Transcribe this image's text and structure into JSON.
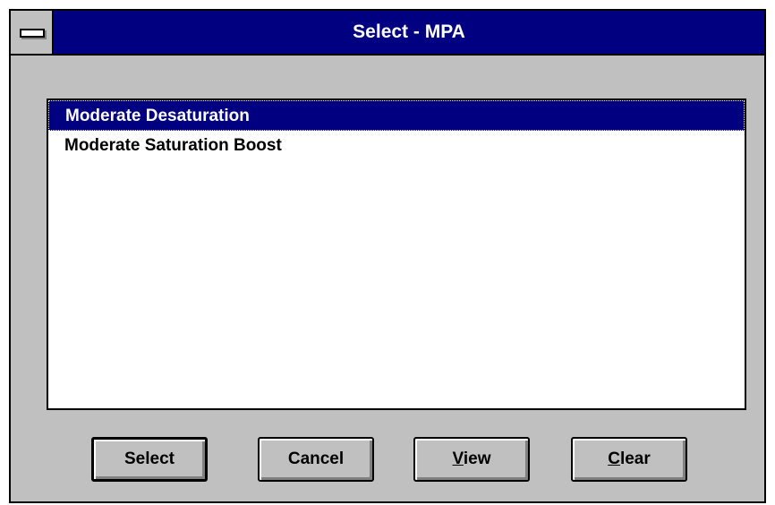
{
  "window": {
    "title": "Select - MPA"
  },
  "listbox": {
    "items": [
      {
        "label": "Moderate Desaturation",
        "selected": true
      },
      {
        "label": "Moderate Saturation Boost",
        "selected": false
      }
    ]
  },
  "buttons": {
    "select": {
      "label": "Select"
    },
    "cancel": {
      "label": "Cancel"
    },
    "view": {
      "mnemonic": "V",
      "rest": "iew"
    },
    "clear": {
      "mnemonic": "C",
      "rest": "lear"
    }
  },
  "colors": {
    "titlebar": "#000080",
    "selection": "#000080",
    "face": "#c0c0c0"
  },
  "icons": {
    "system_menu": "system-menu-icon"
  }
}
